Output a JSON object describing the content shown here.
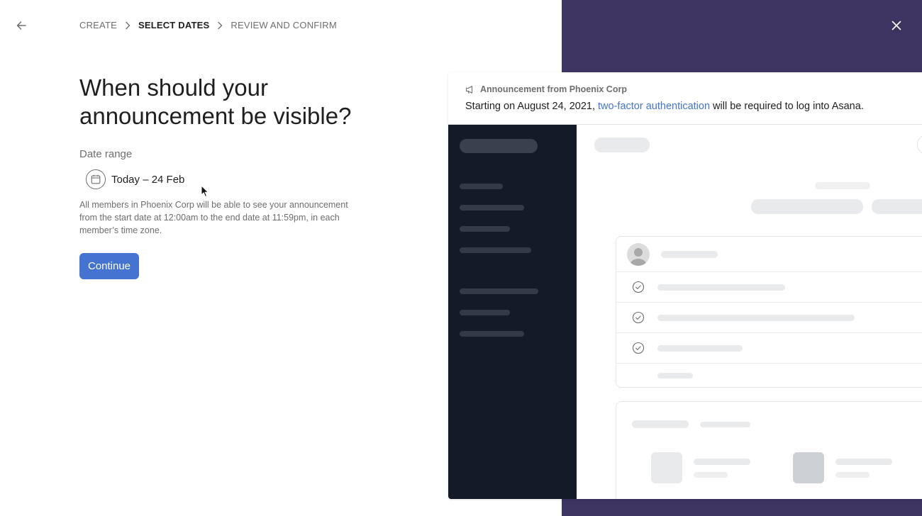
{
  "nav": {
    "back_icon": "arrow-left-icon",
    "close_icon": "close-icon",
    "breadcrumb": [
      {
        "label": "CREATE",
        "active": false
      },
      {
        "label": "SELECT DATES",
        "active": true
      },
      {
        "label": "REVIEW AND CONFIRM",
        "active": false
      }
    ]
  },
  "form": {
    "title": "When should your announcement be visible?",
    "date_range_label": "Date range",
    "date_range_value": "Today – 24 Feb",
    "calendar_icon": "calendar-icon",
    "help_text": "All members in Phoenix Corp will be able to see your announcement from the start date at 12:00am to the end date at 11:59pm, in each member’s time zone.",
    "continue_label": "Continue"
  },
  "preview": {
    "banner_header": "Announcement from Phoenix Corp",
    "banner_icon": "megaphone-icon",
    "banner_text_before": "Starting on August 24, 2021, ",
    "banner_link": "two-factor authentication",
    "banner_text_after": " will be required to log into Asana."
  },
  "colors": {
    "accent": "#4573d2",
    "panel": "#3e3462",
    "sidebar": "#151b26"
  }
}
